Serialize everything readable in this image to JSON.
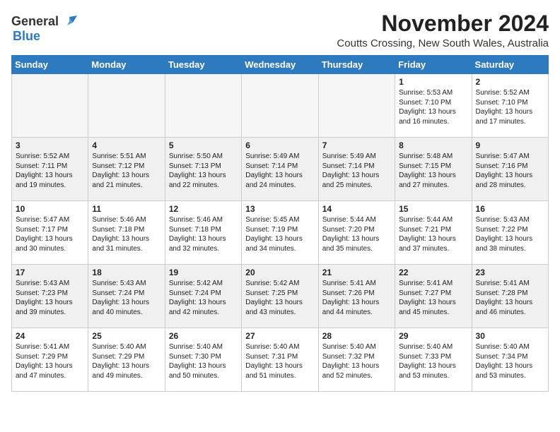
{
  "logo": {
    "general": "General",
    "blue": "Blue"
  },
  "title": "November 2024",
  "location": "Coutts Crossing, New South Wales, Australia",
  "weekdays": [
    "Sunday",
    "Monday",
    "Tuesday",
    "Wednesday",
    "Thursday",
    "Friday",
    "Saturday"
  ],
  "weeks": [
    [
      {
        "day": "",
        "info": ""
      },
      {
        "day": "",
        "info": ""
      },
      {
        "day": "",
        "info": ""
      },
      {
        "day": "",
        "info": ""
      },
      {
        "day": "",
        "info": ""
      },
      {
        "day": "1",
        "info": "Sunrise: 5:53 AM\nSunset: 7:10 PM\nDaylight: 13 hours and 16 minutes."
      },
      {
        "day": "2",
        "info": "Sunrise: 5:52 AM\nSunset: 7:10 PM\nDaylight: 13 hours and 17 minutes."
      }
    ],
    [
      {
        "day": "3",
        "info": "Sunrise: 5:52 AM\nSunset: 7:11 PM\nDaylight: 13 hours and 19 minutes."
      },
      {
        "day": "4",
        "info": "Sunrise: 5:51 AM\nSunset: 7:12 PM\nDaylight: 13 hours and 21 minutes."
      },
      {
        "day": "5",
        "info": "Sunrise: 5:50 AM\nSunset: 7:13 PM\nDaylight: 13 hours and 22 minutes."
      },
      {
        "day": "6",
        "info": "Sunrise: 5:49 AM\nSunset: 7:14 PM\nDaylight: 13 hours and 24 minutes."
      },
      {
        "day": "7",
        "info": "Sunrise: 5:49 AM\nSunset: 7:14 PM\nDaylight: 13 hours and 25 minutes."
      },
      {
        "day": "8",
        "info": "Sunrise: 5:48 AM\nSunset: 7:15 PM\nDaylight: 13 hours and 27 minutes."
      },
      {
        "day": "9",
        "info": "Sunrise: 5:47 AM\nSunset: 7:16 PM\nDaylight: 13 hours and 28 minutes."
      }
    ],
    [
      {
        "day": "10",
        "info": "Sunrise: 5:47 AM\nSunset: 7:17 PM\nDaylight: 13 hours and 30 minutes."
      },
      {
        "day": "11",
        "info": "Sunrise: 5:46 AM\nSunset: 7:18 PM\nDaylight: 13 hours and 31 minutes."
      },
      {
        "day": "12",
        "info": "Sunrise: 5:46 AM\nSunset: 7:18 PM\nDaylight: 13 hours and 32 minutes."
      },
      {
        "day": "13",
        "info": "Sunrise: 5:45 AM\nSunset: 7:19 PM\nDaylight: 13 hours and 34 minutes."
      },
      {
        "day": "14",
        "info": "Sunrise: 5:44 AM\nSunset: 7:20 PM\nDaylight: 13 hours and 35 minutes."
      },
      {
        "day": "15",
        "info": "Sunrise: 5:44 AM\nSunset: 7:21 PM\nDaylight: 13 hours and 37 minutes."
      },
      {
        "day": "16",
        "info": "Sunrise: 5:43 AM\nSunset: 7:22 PM\nDaylight: 13 hours and 38 minutes."
      }
    ],
    [
      {
        "day": "17",
        "info": "Sunrise: 5:43 AM\nSunset: 7:23 PM\nDaylight: 13 hours and 39 minutes."
      },
      {
        "day": "18",
        "info": "Sunrise: 5:43 AM\nSunset: 7:24 PM\nDaylight: 13 hours and 40 minutes."
      },
      {
        "day": "19",
        "info": "Sunrise: 5:42 AM\nSunset: 7:24 PM\nDaylight: 13 hours and 42 minutes."
      },
      {
        "day": "20",
        "info": "Sunrise: 5:42 AM\nSunset: 7:25 PM\nDaylight: 13 hours and 43 minutes."
      },
      {
        "day": "21",
        "info": "Sunrise: 5:41 AM\nSunset: 7:26 PM\nDaylight: 13 hours and 44 minutes."
      },
      {
        "day": "22",
        "info": "Sunrise: 5:41 AM\nSunset: 7:27 PM\nDaylight: 13 hours and 45 minutes."
      },
      {
        "day": "23",
        "info": "Sunrise: 5:41 AM\nSunset: 7:28 PM\nDaylight: 13 hours and 46 minutes."
      }
    ],
    [
      {
        "day": "24",
        "info": "Sunrise: 5:41 AM\nSunset: 7:29 PM\nDaylight: 13 hours and 47 minutes."
      },
      {
        "day": "25",
        "info": "Sunrise: 5:40 AM\nSunset: 7:29 PM\nDaylight: 13 hours and 49 minutes."
      },
      {
        "day": "26",
        "info": "Sunrise: 5:40 AM\nSunset: 7:30 PM\nDaylight: 13 hours and 50 minutes."
      },
      {
        "day": "27",
        "info": "Sunrise: 5:40 AM\nSunset: 7:31 PM\nDaylight: 13 hours and 51 minutes."
      },
      {
        "day": "28",
        "info": "Sunrise: 5:40 AM\nSunset: 7:32 PM\nDaylight: 13 hours and 52 minutes."
      },
      {
        "day": "29",
        "info": "Sunrise: 5:40 AM\nSunset: 7:33 PM\nDaylight: 13 hours and 53 minutes."
      },
      {
        "day": "30",
        "info": "Sunrise: 5:40 AM\nSunset: 7:34 PM\nDaylight: 13 hours and 53 minutes."
      }
    ]
  ]
}
